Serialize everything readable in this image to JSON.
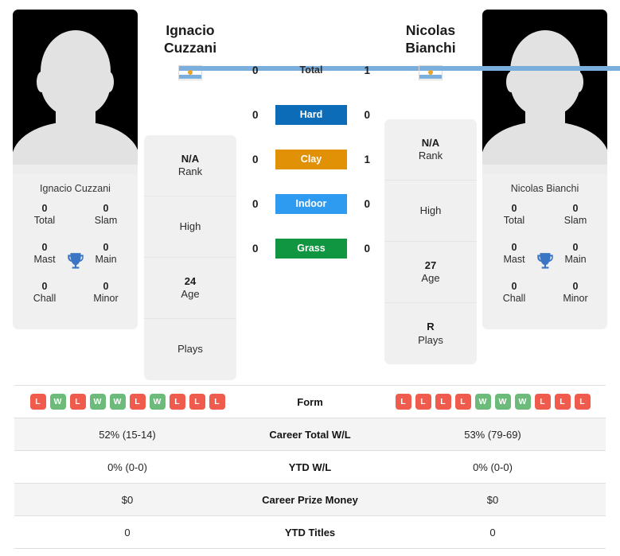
{
  "players": {
    "left": {
      "first_name": "Ignacio",
      "last_name": "Cuzzani",
      "full_name": "Ignacio Cuzzani",
      "flag": "argentina-flag",
      "titles": {
        "total_value": "0",
        "total_label": "Total",
        "slam_value": "0",
        "slam_label": "Slam",
        "mast_value": "0",
        "mast_label": "Mast",
        "main_value": "0",
        "main_label": "Main",
        "chall_value": "0",
        "chall_label": "Chall",
        "minor_value": "0",
        "minor_label": "Minor"
      },
      "info": {
        "rank_value": "N/A",
        "rank_label": "Rank",
        "high_value": "",
        "high_label": "High",
        "age_value": "24",
        "age_label": "Age",
        "plays_value": "",
        "plays_label": "Plays"
      },
      "form": [
        "L",
        "W",
        "L",
        "W",
        "W",
        "L",
        "W",
        "L",
        "L",
        "L"
      ],
      "career_total_wl": "52% (15-14)",
      "ytd_wl": "0% (0-0)",
      "career_prize_money": "$0",
      "ytd_titles": "0"
    },
    "right": {
      "first_name": "Nicolas",
      "last_name": "Bianchi",
      "full_name": "Nicolas Bianchi",
      "flag": "argentina-flag",
      "titles": {
        "total_value": "0",
        "total_label": "Total",
        "slam_value": "0",
        "slam_label": "Slam",
        "mast_value": "0",
        "mast_label": "Mast",
        "main_value": "0",
        "main_label": "Main",
        "chall_value": "0",
        "chall_label": "Chall",
        "minor_value": "0",
        "minor_label": "Minor"
      },
      "info": {
        "rank_value": "N/A",
        "rank_label": "Rank",
        "high_value": "",
        "high_label": "High",
        "age_value": "27",
        "age_label": "Age",
        "plays_value": "R",
        "plays_label": "Plays"
      },
      "form": [
        "L",
        "L",
        "L",
        "L",
        "W",
        "W",
        "W",
        "L",
        "L",
        "L"
      ],
      "career_total_wl": "53% (79-69)",
      "ytd_wl": "0% (0-0)",
      "career_prize_money": "$0",
      "ytd_titles": "0"
    }
  },
  "h2h": {
    "rows": [
      {
        "label": "Total",
        "left": "0",
        "right": "1",
        "style": "plain",
        "color": ""
      },
      {
        "label": "Hard",
        "left": "0",
        "right": "0",
        "style": "badge",
        "color": "#0d6cb8"
      },
      {
        "label": "Clay",
        "left": "0",
        "right": "1",
        "style": "badge",
        "color": "#e09106"
      },
      {
        "label": "Indoor",
        "left": "0",
        "right": "0",
        "style": "badge",
        "color": "#2e9af0"
      },
      {
        "label": "Grass",
        "left": "0",
        "right": "0",
        "style": "badge",
        "color": "#109640"
      }
    ]
  },
  "table": {
    "rows": [
      {
        "label": "Form",
        "key": "form",
        "type": "form"
      },
      {
        "label": "Career Total W/L",
        "key": "career_total_wl",
        "type": "text"
      },
      {
        "label": "YTD W/L",
        "key": "ytd_wl",
        "type": "text"
      },
      {
        "label": "Career Prize Money",
        "key": "career_prize_money",
        "type": "text"
      },
      {
        "label": "YTD Titles",
        "key": "ytd_titles",
        "type": "text"
      }
    ]
  },
  "colors": {
    "win_badge": "#6cbb7b",
    "loss_badge": "#ef5b4c",
    "trophy": "#3a76c4",
    "card_bg": "#f0f0f0",
    "row_alt": "#f4f4f4"
  }
}
